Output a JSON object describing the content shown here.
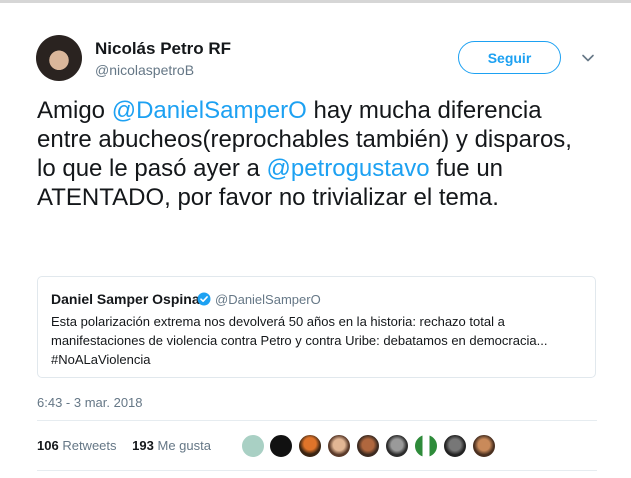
{
  "author": {
    "name": "Nicolás Petro RF",
    "handle": "@nicolaspetroB"
  },
  "follow_label": "Seguir",
  "tweet": {
    "t1": "Amigo ",
    "mention1": "@DanielSamperO",
    "t2": " hay mucha diferencia entre abucheos(reprochables también) y disparos, lo que le pasó ayer a ",
    "mention2": "@petrogustavo",
    "t3": " fue un ATENTADO, por favor no trivializar el tema."
  },
  "quoted": {
    "name": "Daniel Samper Ospina",
    "handle": "@DanielSamperO",
    "line1": "Esta polarización extrema nos devolverá 50 años en la historia: rechazo total a",
    "line2": "manifestaciones de violencia contra Petro y contra Uribe: debatamos en democracia...",
    "line3": "#NoALaViolencia"
  },
  "timestamp": "6:43 - 3 mar. 2018",
  "stats": {
    "retweets_count": "106",
    "retweets_label": "Retweets",
    "likes_count": "193",
    "likes_label": "Me gusta"
  },
  "colors": {
    "accent": "#1da1f2",
    "muted": "#657786",
    "text": "#14171a"
  },
  "icons": [
    "chevron-down-icon",
    "verified-badge-icon"
  ]
}
